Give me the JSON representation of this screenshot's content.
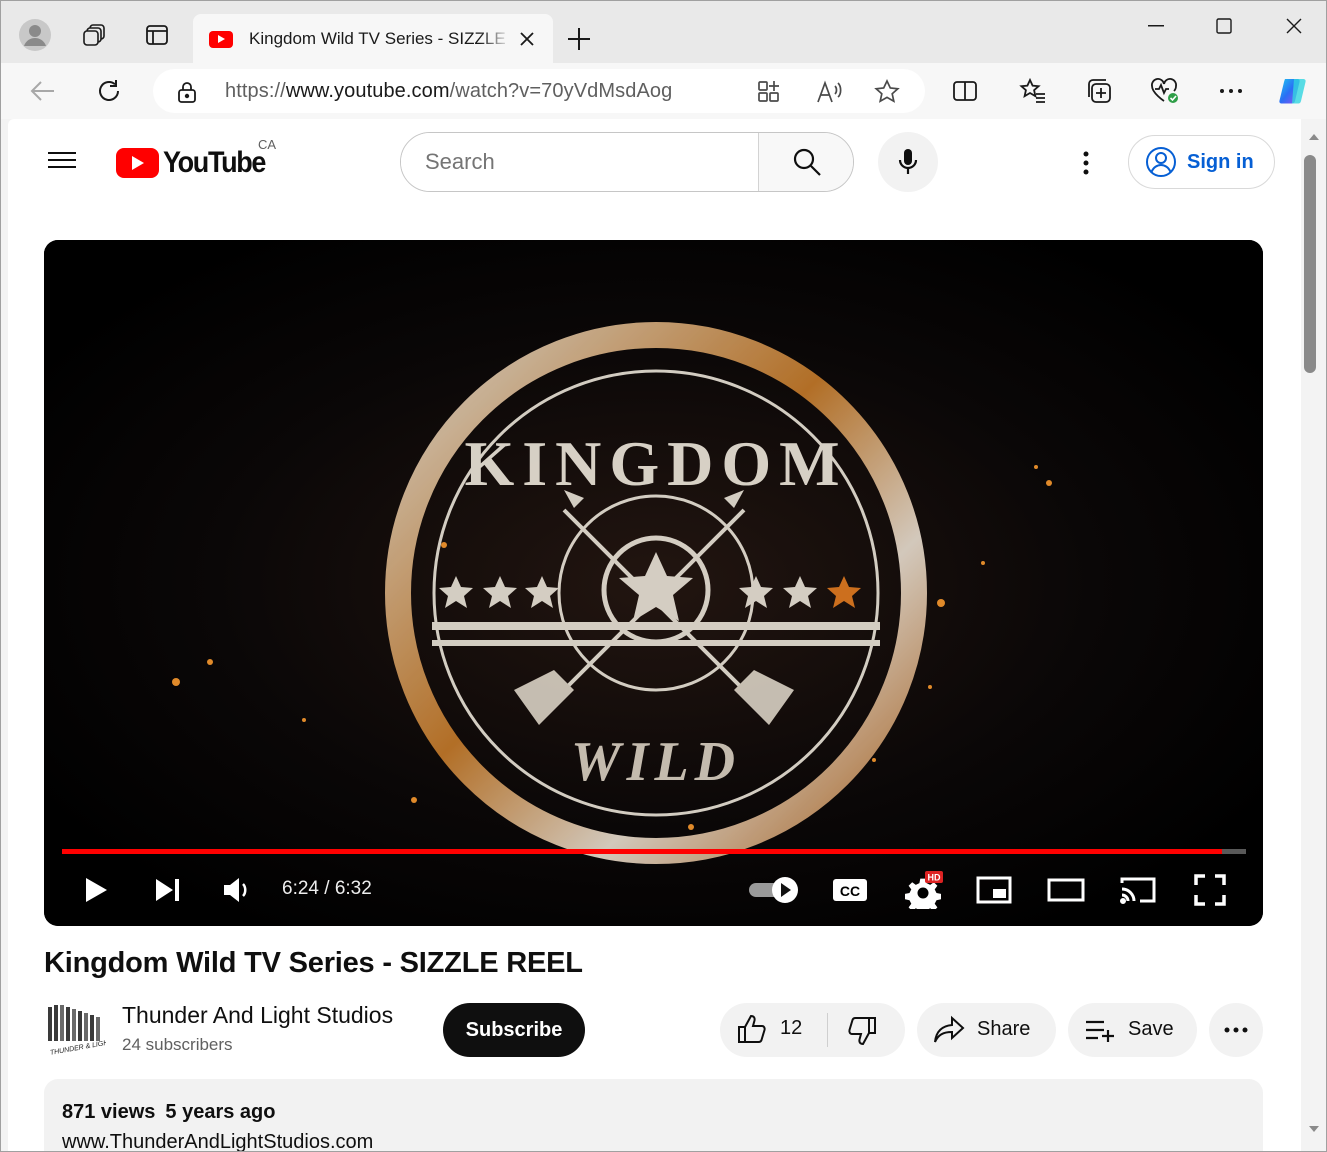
{
  "browser": {
    "tab_title": "Kingdom Wild TV Series - SIZZLE REEL",
    "url_scheme": "https://",
    "url_host": "www.youtube.com",
    "url_path": "/watch?v=70yVdMsdAog"
  },
  "header": {
    "logo_text": "YouTube",
    "country_code": "CA",
    "search_placeholder": "Search",
    "signin_label": "Sign in"
  },
  "player": {
    "current_time": "6:24",
    "duration": "6:32",
    "time_separator": " / ",
    "progress_fraction": 0.98,
    "hd_badge": "HD",
    "overlay_text": [
      "KINGDOM",
      "WILD"
    ]
  },
  "video": {
    "title": "Kingdom Wild TV Series - SIZZLE REEL",
    "channel_name": "Thunder And Light Studios",
    "subscribers": "24 subscribers",
    "subscribe_label": "Subscribe",
    "like_count": "12",
    "share_label": "Share",
    "save_label": "Save",
    "views": "871 views",
    "age": "5 years ago",
    "description_line": "www.ThunderAndLightStudios.com",
    "avatar_text": "THUNDER & LIGHT STUDIOS"
  },
  "colors": {
    "brand_red": "#ff0000",
    "link_blue": "#065fd4",
    "ember_orange": "#e08a2a"
  },
  "icons": [
    "profile-icon",
    "workspaces-icon",
    "tab-actions-icon",
    "youtube-favicon",
    "close-tab-icon",
    "new-tab-icon",
    "minimize-icon",
    "maximize-icon",
    "close-window-icon",
    "back-icon",
    "refresh-icon",
    "lock-icon",
    "apps-icon",
    "read-aloud-icon",
    "favorite-star-icon",
    "split-screen-icon",
    "favorites-icon",
    "collections-icon",
    "health-icon",
    "more-icon",
    "copilot-icon",
    "hamburger-icon",
    "search-icon",
    "mic-icon",
    "kebab-icon",
    "account-icon",
    "play-icon",
    "next-icon",
    "volume-icon",
    "autoplay-toggle-icon",
    "captions-icon",
    "settings-icon",
    "miniplayer-icon",
    "theater-icon",
    "cast-icon",
    "fullscreen-icon",
    "thumbs-up-icon",
    "thumbs-down-icon",
    "share-icon",
    "save-playlist-icon",
    "more-actions-icon"
  ]
}
